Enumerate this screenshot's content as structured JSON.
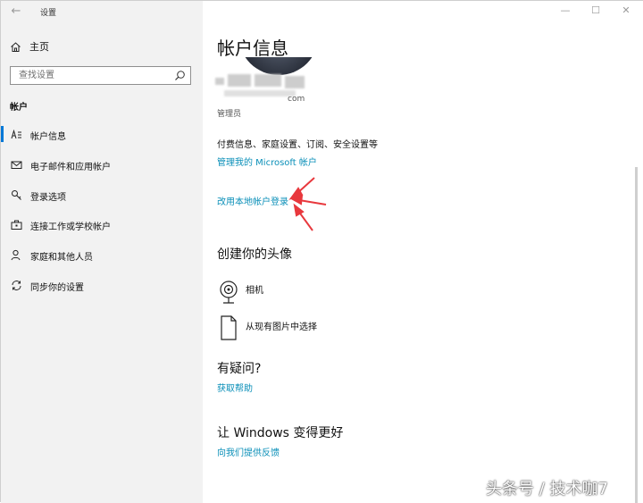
{
  "window": {
    "title": "设置",
    "controls": {
      "minimize": "—",
      "maximize": "☐",
      "close": "✕"
    }
  },
  "sidebar": {
    "home_label": "主页",
    "search_placeholder": "查找设置",
    "section_label": "帐户",
    "items": [
      {
        "label": "帐户信息",
        "icon": "person-card-icon",
        "active": true
      },
      {
        "label": "电子邮件和应用帐户",
        "icon": "mail-icon",
        "active": false
      },
      {
        "label": "登录选项",
        "icon": "key-icon",
        "active": false
      },
      {
        "label": "连接工作或学校帐户",
        "icon": "briefcase-icon",
        "active": false
      },
      {
        "label": "家庭和其他人员",
        "icon": "person-plus-icon",
        "active": false
      },
      {
        "label": "同步你的设置",
        "icon": "sync-icon",
        "active": false
      }
    ]
  },
  "main": {
    "title": "帐户信息",
    "email_tail": "com",
    "role": "管理员",
    "billing_text": "付费信息、家庭设置、订阅、安全设置等",
    "manage_link": "管理我的 Microsoft 帐户",
    "local_account_link": "改用本地帐户登录",
    "avatar_heading": "创建你的头像",
    "avatar_options": [
      {
        "label": "相机",
        "icon": "camera-icon"
      },
      {
        "label": "从现有图片中选择",
        "icon": "document-icon"
      }
    ],
    "help_heading": "有疑问?",
    "help_link": "获取帮助",
    "feedback_heading": "让 Windows 变得更好",
    "feedback_link": "向我们提供反馈"
  },
  "watermark": "头条号 / 技术咖7",
  "colors": {
    "accent": "#0078d7",
    "link": "#0a8fb8",
    "annotation_arrow": "#e8383d",
    "sidebar_bg": "#f2f2f2"
  }
}
